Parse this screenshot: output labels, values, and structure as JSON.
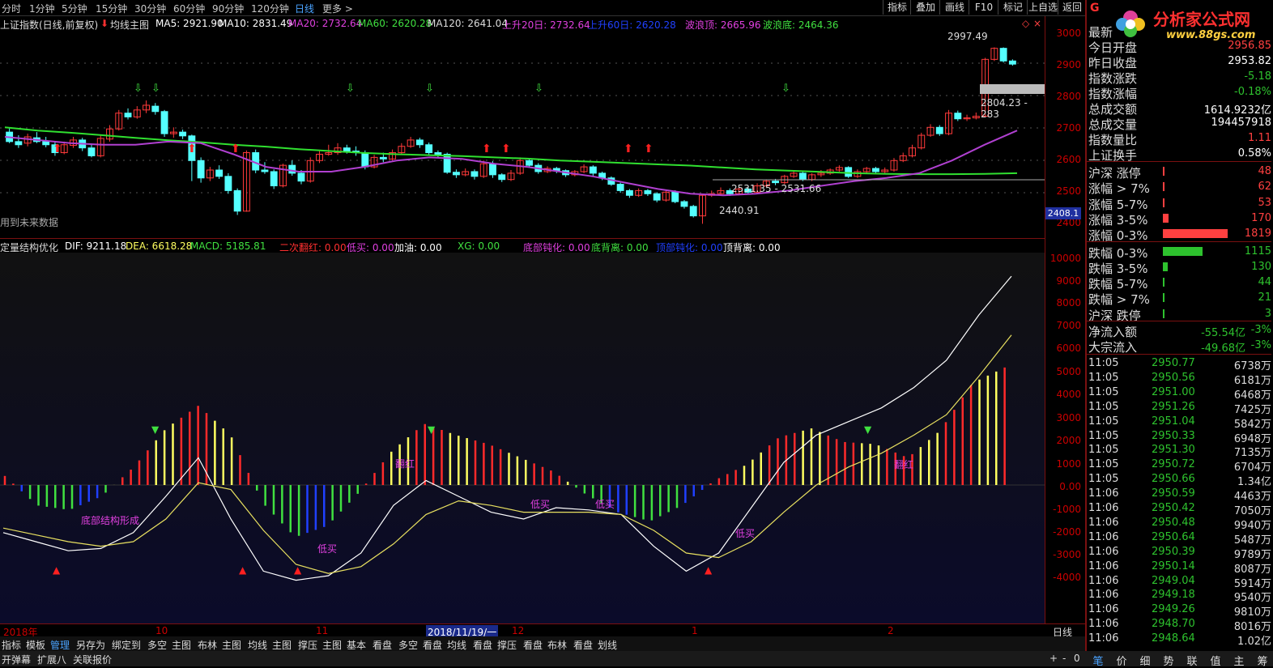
{
  "topbar": {
    "periods": [
      "分时",
      "1分钟",
      "5分钟",
      "15分钟",
      "30分钟",
      "60分钟",
      "90分钟",
      "120分钟",
      "日线",
      "更多 >"
    ],
    "active_period": "日线",
    "buttons": [
      "指标",
      "叠加",
      "画线",
      "F10",
      "标记",
      "上自选",
      "返回"
    ]
  },
  "infoline": {
    "title": "上证指数(日线,前复权)",
    "indicator": "均线主图",
    "ma5": "MA5: 2921.90",
    "ma10": "MA10: 2831.49",
    "ma20": "MA20: 2732.64",
    "ma60": "MA60: 2620.28",
    "ma120": "MA120: 2641.04",
    "up20": "上升20日: 2732.64",
    "up60": "上升60日: 2620.28",
    "wave_top": "波浪顶: 2665.96",
    "wave_bottom": "波浪底: 2464.36",
    "future_note": "用到未来数据",
    "price_high_label": "2997.49",
    "price_mid_label": "2804.23 - 283",
    "price_range_label": "2531.35 - 2531.66",
    "price_low_label": "2440.91",
    "current_tag": "2408.1"
  },
  "macdline": {
    "name": "定量结构优化",
    "dif": "DIF: 9211.18",
    "dea": "DEA: 6618.28",
    "macd": "MACD: 5185.81",
    "f1": "二次翻红: 0.00",
    "f2": "低买: 0.00",
    "f3": "加油: 0.00",
    "f4": "XG: 0.00",
    "f5": "底部钝化: 0.00",
    "f6": "底背离: 0.00",
    "f7": "顶部钝化: 0.00",
    "f8": "顶背离: 0.00"
  },
  "macd_annotations": {
    "a1": "底部结构形成",
    "a2": "低买",
    "a3": "低买",
    "a4": "低买",
    "a5": "低买",
    "a6": "翻红",
    "a7": "翻红"
  },
  "price_axis": [
    "3000",
    "2900",
    "2800",
    "2700",
    "2600",
    "2500",
    "2400"
  ],
  "macd_axis": [
    "10000",
    "9000",
    "8000",
    "7000",
    "6000",
    "5000",
    "4000",
    "3000",
    "2000",
    "1000",
    "0.00",
    "-1000",
    "-2000",
    "-3000",
    "-4000"
  ],
  "dates": {
    "d0": "2018年",
    "d1": "10",
    "d2": "11",
    "d3": "2018/11/19/一",
    "d4": "12",
    "d5": "1",
    "d6": "2",
    "period_label": "日线",
    "controls": [
      "+",
      "-",
      "0"
    ]
  },
  "bottom_tabs": [
    "指标",
    "模板",
    "管理",
    "另存为",
    "绑定到",
    "多空",
    "主图",
    "布林",
    "主图",
    "均线",
    "主图",
    "撑压",
    "主图",
    "基本",
    "看盘",
    "多空",
    "看盘",
    "均线",
    "看盘",
    "撑压",
    "看盘",
    "布林",
    "看盘",
    "划线"
  ],
  "active_tab": "管理",
  "status": [
    "开弹幕",
    "扩展八",
    "关联报价"
  ],
  "logo": {
    "brand": "分析家公式网",
    "url": "www.88gs.com"
  },
  "quote": {
    "rows": [
      {
        "label": "最新",
        "value": "",
        "color": "#ff4040"
      },
      {
        "label": "今日开盘",
        "value": "2956.85",
        "color": "#ff4040"
      },
      {
        "label": "昨日收盘",
        "value": "2953.82",
        "color": "#ffffff"
      },
      {
        "label": "指数涨跌",
        "value": "-5.18",
        "color": "#2ec22e"
      },
      {
        "label": "指数涨幅",
        "value": "-0.18%",
        "color": "#2ec22e"
      },
      {
        "label": "总成交额",
        "value": "1614.9232亿",
        "color": "#ffffff"
      },
      {
        "label": "总成交量",
        "value": "194457918",
        "color": "#ffffff"
      },
      {
        "label": "指数量比",
        "value": "1.11",
        "color": "#ff4040"
      },
      {
        "label": "上证换手",
        "value": "0.58%",
        "color": "#ffffff"
      }
    ],
    "breadth": [
      {
        "label": "沪深 涨停",
        "value": "48",
        "color": "#ff4040",
        "bar": 0.02
      },
      {
        "label": "涨幅 > 7%",
        "value": "62",
        "color": "#ff4040",
        "bar": 0.03
      },
      {
        "label": "涨幅 5-7%",
        "value": "53",
        "color": "#ff4040",
        "bar": 0.025
      },
      {
        "label": "涨幅 3-5%",
        "value": "170",
        "color": "#ff4040",
        "bar": 0.09
      },
      {
        "label": "涨幅 0-3%",
        "value": "1819",
        "color": "#ff4040",
        "bar": 1.0
      },
      {
        "label": "跌幅 0-3%",
        "value": "1115",
        "color": "#2ec22e",
        "bar": 0.61
      },
      {
        "label": "跌幅 3-5%",
        "value": "130",
        "color": "#2ec22e",
        "bar": 0.07
      },
      {
        "label": "跌幅 5-7%",
        "value": "44",
        "color": "#2ec22e",
        "bar": 0.02
      },
      {
        "label": "跌幅 > 7%",
        "value": "21",
        "color": "#2ec22e",
        "bar": 0.01
      },
      {
        "label": "沪深 跌停",
        "value": "3",
        "color": "#2ec22e",
        "bar": 0.005
      }
    ],
    "flows": [
      {
        "label": "净流入额",
        "value": "-55.54亿",
        "pct": "-3%"
      },
      {
        "label": "大宗流入",
        "value": "-49.68亿",
        "pct": "-3%"
      }
    ],
    "ticks": [
      {
        "t": "11:05",
        "p": "2950.77",
        "v": "6738万"
      },
      {
        "t": "11:05",
        "p": "2950.56",
        "v": "6181万"
      },
      {
        "t": "11:05",
        "p": "2951.00",
        "v": "6468万"
      },
      {
        "t": "11:05",
        "p": "2951.26",
        "v": "7425万"
      },
      {
        "t": "11:05",
        "p": "2951.04",
        "v": "5842万"
      },
      {
        "t": "11:05",
        "p": "2950.33",
        "v": "6948万"
      },
      {
        "t": "11:05",
        "p": "2951.30",
        "v": "7135万"
      },
      {
        "t": "11:05",
        "p": "2950.72",
        "v": "6704万"
      },
      {
        "t": "11:05",
        "p": "2950.66",
        "v": "1.34亿"
      },
      {
        "t": "11:06",
        "p": "2950.59",
        "v": "4463万"
      },
      {
        "t": "11:06",
        "p": "2950.42",
        "v": "7050万"
      },
      {
        "t": "11:06",
        "p": "2950.48",
        "v": "9940万"
      },
      {
        "t": "11:06",
        "p": "2950.64",
        "v": "5487万"
      },
      {
        "t": "11:06",
        "p": "2950.39",
        "v": "9789万"
      },
      {
        "t": "11:06",
        "p": "2950.14",
        "v": "8087万"
      },
      {
        "t": "11:06",
        "p": "2949.04",
        "v": "5914万"
      },
      {
        "t": "11:06",
        "p": "2949.18",
        "v": "9540万"
      },
      {
        "t": "11:06",
        "p": "2949.26",
        "v": "9810万"
      },
      {
        "t": "11:06",
        "p": "2948.70",
        "v": "8016万"
      },
      {
        "t": "11:06",
        "p": "2948.64",
        "v": "1.02亿"
      }
    ],
    "bottom_tabs": [
      "笔",
      "价",
      "细",
      "势",
      "联",
      "值",
      "主",
      "筹"
    ]
  },
  "chart_data": {
    "type": "candlestick",
    "title": "上证指数(日线,前复权)",
    "ylim": [
      2400,
      3030
    ],
    "candles": [
      [
        2730,
        2700,
        2745,
        2695
      ],
      [
        2700,
        2690,
        2720,
        2680
      ],
      [
        2695,
        2715,
        2725,
        2685
      ],
      [
        2712,
        2700,
        2730,
        2695
      ],
      [
        2700,
        2690,
        2715,
        2682
      ],
      [
        2690,
        2665,
        2700,
        2655
      ],
      [
        2665,
        2690,
        2700,
        2660
      ],
      [
        2688,
        2705,
        2715,
        2680
      ],
      [
        2705,
        2680,
        2712,
        2670
      ],
      [
        2680,
        2655,
        2690,
        2650
      ],
      [
        2655,
        2710,
        2720,
        2650
      ],
      [
        2708,
        2740,
        2752,
        2700
      ],
      [
        2740,
        2790,
        2800,
        2735
      ],
      [
        2790,
        2778,
        2805,
        2770
      ],
      [
        2778,
        2800,
        2812,
        2772
      ],
      [
        2800,
        2815,
        2830,
        2790
      ],
      [
        2812,
        2795,
        2822,
        2785
      ],
      [
        2795,
        2725,
        2800,
        2715
      ],
      [
        2725,
        2730,
        2745,
        2712
      ],
      [
        2730,
        2718,
        2738,
        2708
      ],
      [
        2718,
        2640,
        2722,
        2575
      ],
      [
        2640,
        2585,
        2650,
        2570
      ],
      [
        2585,
        2610,
        2620,
        2575
      ],
      [
        2610,
        2590,
        2625,
        2582
      ],
      [
        2590,
        2545,
        2600,
        2535
      ],
      [
        2545,
        2480,
        2552,
        2468
      ],
      [
        2480,
        2665,
        2672,
        2478
      ],
      [
        2665,
        2610,
        2675,
        2600
      ],
      [
        2610,
        2605,
        2635,
        2598
      ],
      [
        2605,
        2560,
        2612,
        2550
      ],
      [
        2560,
        2625,
        2630,
        2555
      ],
      [
        2625,
        2600,
        2640,
        2592
      ],
      [
        2600,
        2575,
        2610,
        2565
      ],
      [
        2575,
        2640,
        2650,
        2570
      ],
      [
        2640,
        2660,
        2670,
        2632
      ],
      [
        2660,
        2665,
        2690,
        2655
      ],
      [
        2665,
        2680,
        2695,
        2658
      ],
      [
        2680,
        2670,
        2690,
        2662
      ],
      [
        2670,
        2665,
        2685,
        2655
      ],
      [
        2665,
        2620,
        2672,
        2612
      ],
      [
        2620,
        2650,
        2658,
        2615
      ],
      [
        2650,
        2645,
        2665,
        2635
      ],
      [
        2645,
        2665,
        2675,
        2640
      ],
      [
        2665,
        2685,
        2695,
        2660
      ],
      [
        2685,
        2705,
        2715,
        2680
      ],
      [
        2705,
        2690,
        2712,
        2680
      ],
      [
        2690,
        2665,
        2697,
        2655
      ],
      [
        2665,
        2660,
        2672,
        2648
      ],
      [
        2660,
        2603,
        2665,
        2598
      ],
      [
        2603,
        2595,
        2612,
        2585
      ],
      [
        2595,
        2605,
        2615,
        2590
      ],
      [
        2605,
        2590,
        2612,
        2580
      ],
      [
        2590,
        2630,
        2640,
        2585
      ],
      [
        2630,
        2595,
        2638,
        2585
      ],
      [
        2595,
        2580,
        2600,
        2572
      ],
      [
        2580,
        2600,
        2610,
        2575
      ],
      [
        2600,
        2640,
        2650,
        2595
      ],
      [
        2640,
        2625,
        2648,
        2618
      ],
      [
        2625,
        2605,
        2632,
        2598
      ],
      [
        2605,
        2615,
        2622,
        2600
      ],
      [
        2615,
        2608,
        2620,
        2600
      ],
      [
        2608,
        2595,
        2612,
        2588
      ],
      [
        2595,
        2605,
        2610,
        2590
      ],
      [
        2605,
        2620,
        2628,
        2600
      ],
      [
        2620,
        2600,
        2625,
        2592
      ],
      [
        2600,
        2585,
        2605,
        2578
      ],
      [
        2585,
        2565,
        2590,
        2560
      ],
      [
        2565,
        2545,
        2570,
        2538
      ],
      [
        2545,
        2530,
        2550,
        2522
      ],
      [
        2530,
        2545,
        2552,
        2525
      ],
      [
        2545,
        2535,
        2550,
        2528
      ],
      [
        2535,
        2515,
        2540,
        2508
      ],
      [
        2515,
        2540,
        2545,
        2510
      ],
      [
        2540,
        2510,
        2546,
        2505
      ],
      [
        2510,
        2495,
        2515,
        2488
      ],
      [
        2495,
        2465,
        2500,
        2460
      ],
      [
        2465,
        2530,
        2535,
        2440
      ],
      [
        2530,
        2535,
        2545,
        2525
      ],
      [
        2535,
        2545,
        2555,
        2530
      ],
      [
        2545,
        2535,
        2552,
        2528
      ],
      [
        2535,
        2550,
        2558,
        2530
      ],
      [
        2550,
        2540,
        2555,
        2535
      ],
      [
        2540,
        2560,
        2568,
        2535
      ],
      [
        2560,
        2575,
        2580,
        2555
      ],
      [
        2575,
        2570,
        2582,
        2562
      ],
      [
        2570,
        2590,
        2595,
        2565
      ],
      [
        2590,
        2600,
        2610,
        2585
      ],
      [
        2600,
        2580,
        2605,
        2575
      ],
      [
        2580,
        2595,
        2600,
        2575
      ],
      [
        2595,
        2600,
        2610,
        2588
      ],
      [
        2600,
        2610,
        2615,
        2595
      ],
      [
        2610,
        2618,
        2625,
        2605
      ],
      [
        2618,
        2590,
        2622,
        2585
      ],
      [
        2590,
        2605,
        2612,
        2585
      ],
      [
        2605,
        2615,
        2620,
        2598
      ],
      [
        2615,
        2605,
        2620,
        2598
      ],
      [
        2605,
        2610,
        2618,
        2600
      ],
      [
        2610,
        2640,
        2648,
        2605
      ],
      [
        2640,
        2655,
        2665,
        2635
      ],
      [
        2655,
        2680,
        2690,
        2650
      ],
      [
        2680,
        2720,
        2728,
        2675
      ],
      [
        2720,
        2745,
        2755,
        2715
      ],
      [
        2745,
        2725,
        2752,
        2718
      ],
      [
        2725,
        2790,
        2800,
        2720
      ],
      [
        2790,
        2772,
        2798,
        2765
      ],
      [
        2772,
        2775,
        2785,
        2765
      ],
      [
        2775,
        2780,
        2792,
        2770
      ],
      [
        2780,
        2960,
        2965,
        2778
      ],
      [
        2960,
        2995,
        2998,
        2955
      ],
      [
        2995,
        2955,
        2998,
        2950
      ],
      [
        2955,
        2945,
        2960,
        2940
      ]
    ],
    "ma_green": [
      2745,
      2735,
      2728,
      2720,
      2712,
      2704,
      2698,
      2690,
      2684,
      2676,
      2670,
      2664,
      2660,
      2657,
      2654,
      2650,
      2646,
      2640,
      2636,
      2632,
      2628,
      2624,
      2618,
      2612,
      2608,
      2604,
      2600,
      2598,
      2597,
      2597,
      2598,
      2600
    ],
    "ma_purple": [
      2715,
      2705,
      2695,
      2690,
      2690,
      2700,
      2695,
      2660,
      2620,
      2605,
      2605,
      2620,
      2640,
      2650,
      2645,
      2630,
      2620,
      2605,
      2590,
      2570,
      2550,
      2535,
      2530,
      2535,
      2545,
      2560,
      2575,
      2585,
      2600,
      2640,
      2690,
      2735
    ],
    "macd": {
      "dif": [
        -2100,
        -2500,
        -2900,
        -2800,
        -2100,
        -500,
        1200,
        -1500,
        -3800,
        -4200,
        -4000,
        -3000,
        -900,
        200,
        -500,
        -1200,
        -1500,
        -1000,
        -1100,
        -1300,
        -2700,
        -3800,
        -3000,
        -1000,
        1000,
        2200,
        2800,
        3400,
        4300,
        5500,
        7500,
        9211
      ],
      "dea": [
        -1900,
        -2200,
        -2500,
        -2700,
        -2500,
        -1500,
        100,
        -200,
        -2000,
        -3500,
        -3900,
        -3600,
        -2600,
        -1300,
        -700,
        -900,
        -1200,
        -1200,
        -1200,
        -1300,
        -2000,
        -3000,
        -3200,
        -2500,
        -1200,
        0,
        800,
        1400,
        2200,
        3100,
        4800,
        6618
      ],
      "hist": [
        400,
        -900,
        -1100,
        -500,
        800,
        2500,
        3500,
        2200,
        -800,
        -2300,
        -1800,
        -300,
        1500,
        2700,
        2200,
        1800,
        1200,
        600,
        -400,
        -1200,
        -1600,
        -900,
        200,
        900,
        2100,
        2500,
        1900,
        1800,
        1200,
        2400,
        4500,
        5185
      ]
    }
  }
}
